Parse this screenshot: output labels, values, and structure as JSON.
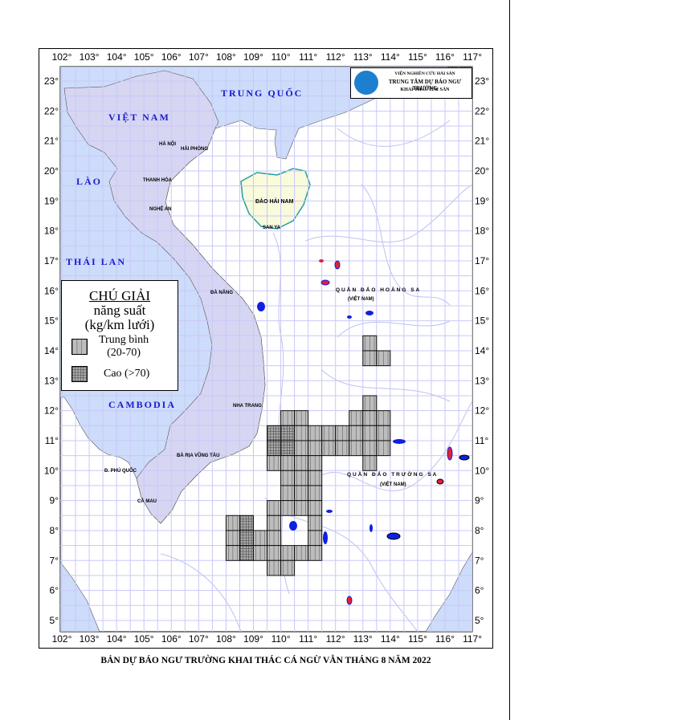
{
  "lon_ticks": [
    "102°",
    "103°",
    "104°",
    "105°",
    "106°",
    "107°",
    "108°",
    "109°",
    "110°",
    "111°",
    "112°",
    "113°",
    "114°",
    "115°",
    "116°",
    "117°"
  ],
  "lat_ticks": [
    "23°",
    "22°",
    "21°",
    "20°",
    "19°",
    "18°",
    "17°",
    "16°",
    "15°",
    "14°",
    "13°",
    "12°",
    "11°",
    "10°",
    "9°",
    "8°",
    "7°",
    "6°",
    "5°"
  ],
  "countries": {
    "china": "TRUNG QUỐC",
    "vietnam": "VIỆT NAM",
    "laos": "LÀO",
    "thailand": "THÁI LAN",
    "cambodia": "CAMBODIA"
  },
  "places": {
    "hanoi": "HÀ NỘI",
    "haiphong": "HẢI PHÒNG",
    "thanhhoa": "THANH HÓA",
    "nghean": "NGHỆ AN",
    "danang": "ĐÀ NẴNG",
    "nhatrang": "NHA TRANG",
    "vungtau": "BÀ RỊA VŨNG TÀU",
    "camau": "CÀ MAU",
    "phuquoc": "Đ. PHÚ QUỐC",
    "hainan": "ĐẢO HẢI NAM",
    "sanya": "SAN YA"
  },
  "archipelagos": {
    "hoangsa": "QUẦN ĐẢO HOÀNG SA",
    "hoangsa_note": "(VIỆT NAM)",
    "truongsa": "QUẦN ĐẢO TRƯỜNG SA",
    "truongsa_note": "(VIỆT NAM)"
  },
  "logo": {
    "line1": "VIỆN NGHIÊN CỨU HẢI SẢN",
    "line2": "TRUNG TÂM DỰ BÁO NGƯ TRƯỜNG",
    "line3": "KHAI THÁC HẢI SẢN"
  },
  "legend": {
    "title": "CHÚ GIẢI",
    "subtitle": "năng suất",
    "unit": "(kg/km lưới)",
    "medium_label": "Trung bình",
    "medium_range": "(20-70)",
    "high_label": "Cao (>70)"
  },
  "caption": "BẢN DỰ BÁO NGƯ TRƯỜNG KHAI THÁC CÁ NGỪ VẰN THÁNG 8 NĂM 2022",
  "colors": {
    "vietnam": "#d6d6f2",
    "other_land": "#cddcfa",
    "hainan": "#fafadc",
    "grid": "#c8c8f8",
    "medium": "#bdbdbd",
    "high": "#9a9a9a"
  },
  "map_extent": {
    "lon": [
      102,
      117
    ],
    "lat": [
      5,
      23
    ]
  },
  "forecast_cells": [
    {
      "lon": 113,
      "lat": 14.5,
      "level": "medium"
    },
    {
      "lon": 113,
      "lat": 14,
      "level": "medium"
    },
    {
      "lon": 113.5,
      "lat": 14,
      "level": "medium"
    },
    {
      "lon": 113,
      "lat": 12.5,
      "level": "medium"
    },
    {
      "lon": 110,
      "lat": 12,
      "level": "medium"
    },
    {
      "lon": 110.5,
      "lat": 12,
      "level": "medium"
    },
    {
      "lon": 112.5,
      "lat": 12,
      "level": "medium"
    },
    {
      "lon": 113,
      "lat": 12,
      "level": "medium"
    },
    {
      "lon": 113.5,
      "lat": 12,
      "level": "medium"
    },
    {
      "lon": 109.5,
      "lat": 11.5,
      "level": "high"
    },
    {
      "lon": 110,
      "lat": 11.5,
      "level": "high"
    },
    {
      "lon": 110.5,
      "lat": 11.5,
      "level": "medium"
    },
    {
      "lon": 111,
      "lat": 11.5,
      "level": "medium"
    },
    {
      "lon": 111.5,
      "lat": 11.5,
      "level": "medium"
    },
    {
      "lon": 112,
      "lat": 11.5,
      "level": "medium"
    },
    {
      "lon": 112.5,
      "lat": 11.5,
      "level": "medium"
    },
    {
      "lon": 113,
      "lat": 11.5,
      "level": "medium"
    },
    {
      "lon": 113.5,
      "lat": 11.5,
      "level": "medium"
    },
    {
      "lon": 109.5,
      "lat": 11,
      "level": "high"
    },
    {
      "lon": 110,
      "lat": 11,
      "level": "high"
    },
    {
      "lon": 110.5,
      "lat": 11,
      "level": "medium"
    },
    {
      "lon": 111,
      "lat": 11,
      "level": "medium"
    },
    {
      "lon": 111.5,
      "lat": 11,
      "level": "medium"
    },
    {
      "lon": 112,
      "lat": 11,
      "level": "medium"
    },
    {
      "lon": 112.5,
      "lat": 11,
      "level": "medium"
    },
    {
      "lon": 113,
      "lat": 11,
      "level": "medium"
    },
    {
      "lon": 113.5,
      "lat": 11,
      "level": "medium"
    },
    {
      "lon": 109.5,
      "lat": 10.5,
      "level": "medium"
    },
    {
      "lon": 110,
      "lat": 10.5,
      "level": "medium"
    },
    {
      "lon": 110.5,
      "lat": 10.5,
      "level": "medium"
    },
    {
      "lon": 111,
      "lat": 10.5,
      "level": "medium"
    },
    {
      "lon": 113,
      "lat": 10.5,
      "level": "medium"
    },
    {
      "lon": 110,
      "lat": 10,
      "level": "medium"
    },
    {
      "lon": 110.5,
      "lat": 10,
      "level": "medium"
    },
    {
      "lon": 111,
      "lat": 10,
      "level": "medium"
    },
    {
      "lon": 110,
      "lat": 9.5,
      "level": "medium"
    },
    {
      "lon": 110.5,
      "lat": 9.5,
      "level": "medium"
    },
    {
      "lon": 111,
      "lat": 9.5,
      "level": "medium"
    },
    {
      "lon": 109.5,
      "lat": 9,
      "level": "medium"
    },
    {
      "lon": 110,
      "lat": 9,
      "level": "medium"
    },
    {
      "lon": 110.5,
      "lat": 9,
      "level": "medium"
    },
    {
      "lon": 111,
      "lat": 9,
      "level": "medium"
    },
    {
      "lon": 108,
      "lat": 8.5,
      "level": "medium"
    },
    {
      "lon": 108.5,
      "lat": 8.5,
      "level": "high"
    },
    {
      "lon": 109.5,
      "lat": 8.5,
      "level": "medium"
    },
    {
      "lon": 111,
      "lat": 8.5,
      "level": "medium"
    },
    {
      "lon": 108,
      "lat": 8,
      "level": "medium"
    },
    {
      "lon": 108.5,
      "lat": 8,
      "level": "high"
    },
    {
      "lon": 109,
      "lat": 8,
      "level": "medium"
    },
    {
      "lon": 109.5,
      "lat": 8,
      "level": "medium"
    },
    {
      "lon": 111,
      "lat": 8,
      "level": "medium"
    },
    {
      "lon": 108,
      "lat": 7.5,
      "level": "medium"
    },
    {
      "lon": 108.5,
      "lat": 7.5,
      "level": "high"
    },
    {
      "lon": 109,
      "lat": 7.5,
      "level": "medium"
    },
    {
      "lon": 109.5,
      "lat": 7.5,
      "level": "medium"
    },
    {
      "lon": 110,
      "lat": 7.5,
      "level": "medium"
    },
    {
      "lon": 110.5,
      "lat": 7.5,
      "level": "medium"
    },
    {
      "lon": 111,
      "lat": 7.5,
      "level": "medium"
    },
    {
      "lon": 109.5,
      "lat": 7,
      "level": "medium"
    },
    {
      "lon": 110,
      "lat": 7,
      "level": "medium"
    }
  ]
}
